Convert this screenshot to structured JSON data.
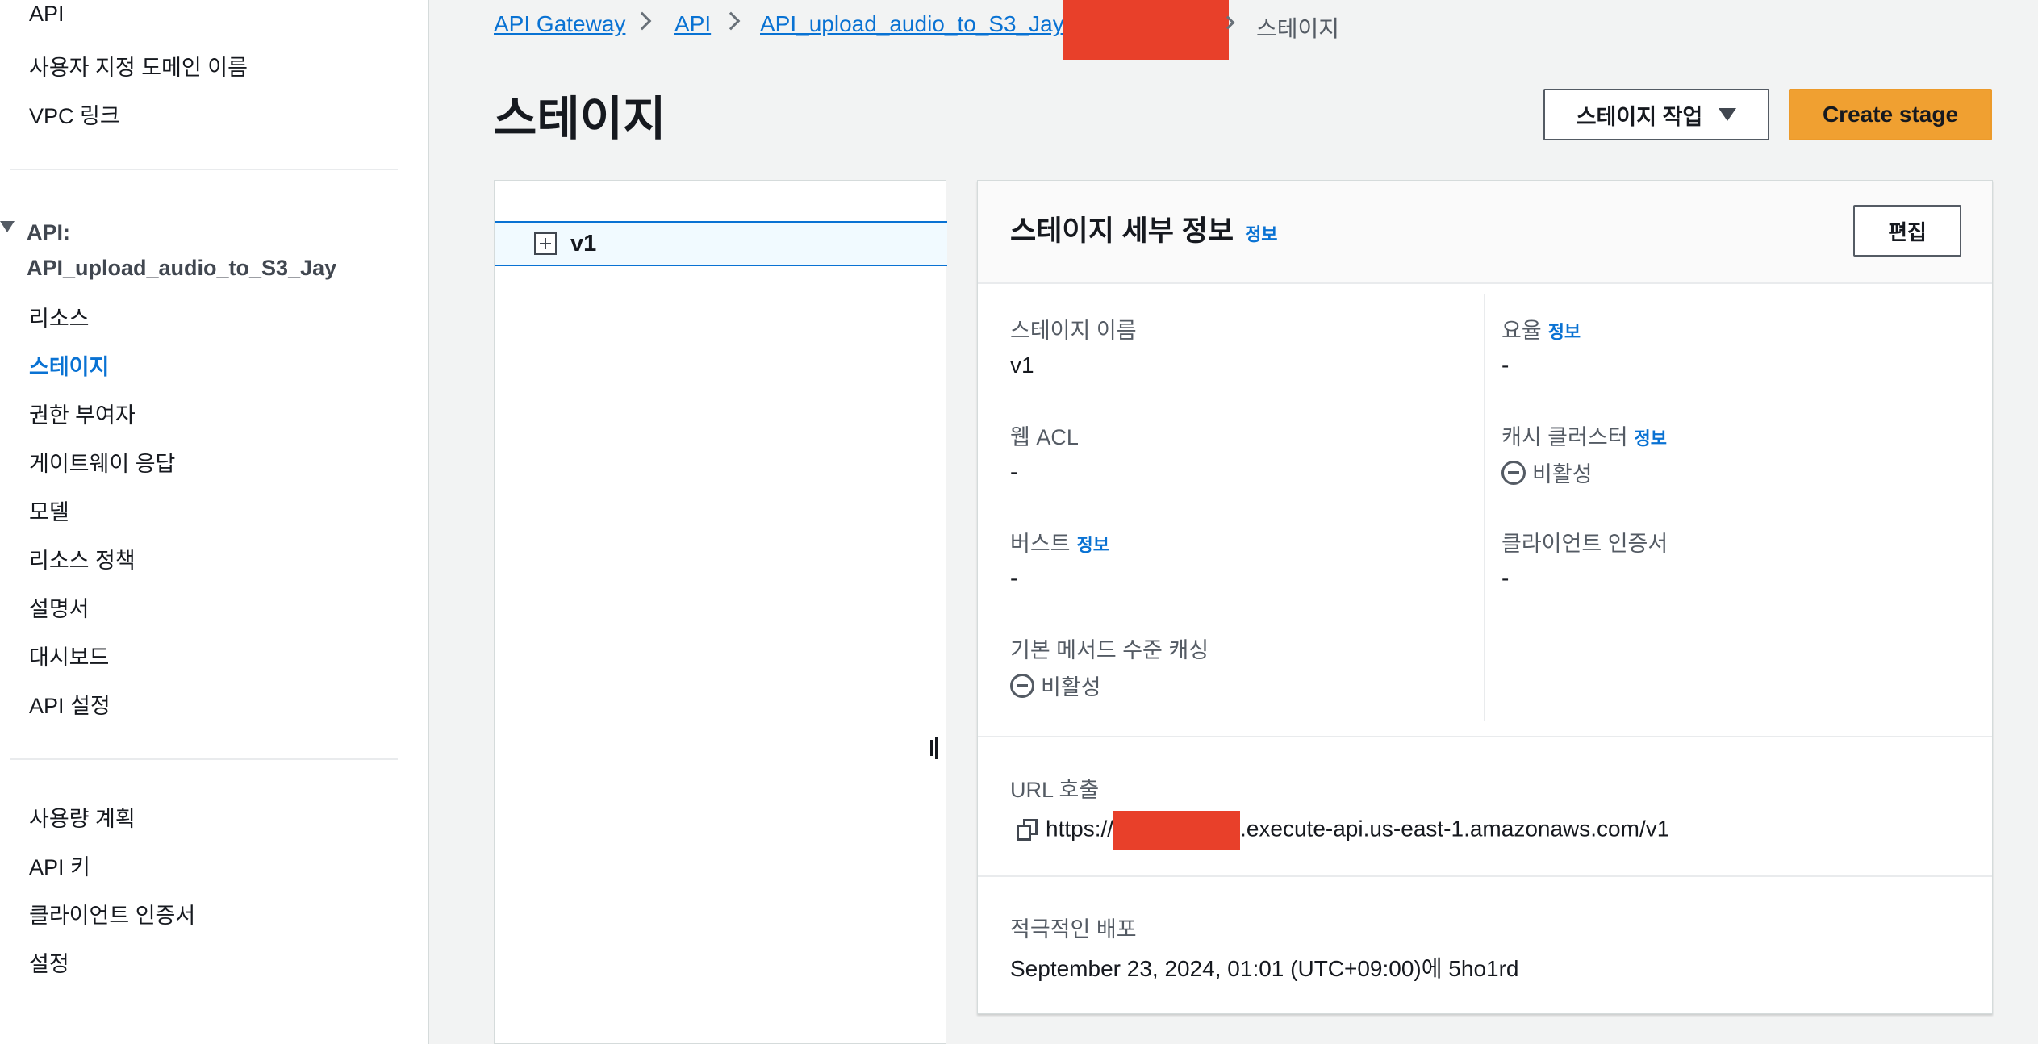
{
  "sidebar": {
    "top_items": [
      {
        "label": "API"
      },
      {
        "label": "사용자 지정 도메인 이름"
      },
      {
        "label": "VPC 링크"
      }
    ],
    "api_section": {
      "title_line1": "API:",
      "title_line2": "API_upload_audio_to_S3_Jay",
      "items": [
        {
          "label": "리소스"
        },
        {
          "label": "스테이지",
          "active": true
        },
        {
          "label": "권한 부여자"
        },
        {
          "label": "게이트웨이 응답"
        },
        {
          "label": "모델"
        },
        {
          "label": "리소스 정책"
        },
        {
          "label": "설명서"
        },
        {
          "label": "대시보드"
        },
        {
          "label": "API 설정"
        }
      ]
    },
    "bottom_items": [
      {
        "label": "사용량 계획"
      },
      {
        "label": "API 키"
      },
      {
        "label": "클라이언트 인증서"
      },
      {
        "label": "설정"
      }
    ]
  },
  "breadcrumb": {
    "items": [
      "API Gateway",
      "API",
      "API_upload_audio_to_S3_Jay"
    ],
    "current": "스테이지"
  },
  "page": {
    "title": "스테이지",
    "actions_button": "스테이지 작업",
    "create_button": "Create stage"
  },
  "tree": {
    "stages": [
      {
        "label": "v1"
      }
    ]
  },
  "details": {
    "title": "스테이지 세부 정보",
    "info": "정보",
    "edit_button": "편집",
    "stage_name_label": "스테이지 이름",
    "stage_name_value": "v1",
    "rate_label": "요율",
    "rate_value": "-",
    "web_acl_label": "웹 ACL",
    "web_acl_value": "-",
    "cache_cluster_label": "캐시 클러스터",
    "cache_cluster_value": "비활성",
    "burst_label": "버스트",
    "burst_value": "-",
    "client_cert_label": "클라이언트 인증서",
    "client_cert_value": "-",
    "method_cache_label": "기본 메서드 수준 캐싱",
    "method_cache_value": "비활성",
    "invoke_url_label": "URL 호출",
    "invoke_url_prefix": "https://",
    "invoke_url_suffix": ".execute-api.us-east-1.amazonaws.com/v1",
    "active_deploy_label": "적극적인 배포",
    "active_deploy_value": "September 23, 2024, 01:01 (UTC+09:00)에 5ho1rd"
  },
  "colors": {
    "link": "#0972d3",
    "primary_button": "#f0a031",
    "redaction": "#e8402a"
  }
}
